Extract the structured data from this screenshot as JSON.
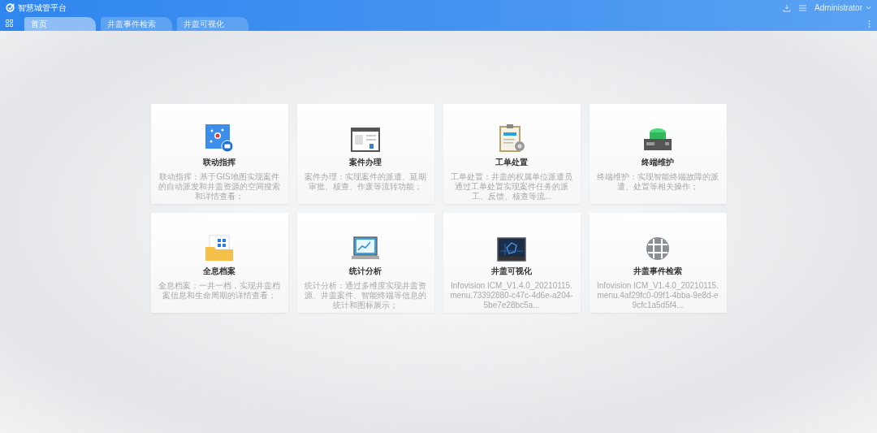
{
  "header": {
    "title": "智慧城管平台",
    "user": "Administrator"
  },
  "tabs": [
    {
      "label": "首页",
      "selected": true
    },
    {
      "label": "井盖事件检索",
      "selected": false
    },
    {
      "label": "井盖可视化",
      "selected": false
    }
  ],
  "modules": [
    {
      "kind": "network",
      "title": "联动指挥",
      "description": "联动指挥：基于GIS地图实现案件的自动派发和井盖资源的空间搜索和详情查看；"
    },
    {
      "kind": "document",
      "title": "案件办理",
      "description": "案件办理：实现案件的派遣、延期审批、核查、作废等流转功能；"
    },
    {
      "kind": "clipboard",
      "title": "工单处置",
      "description": "工单处置：井盖的权属单位派遣员通过工单处置实现案件任务的派工、反馈、核查等流..."
    },
    {
      "kind": "device",
      "title": "终端维护",
      "description": "终端维护：实现智能终端故障的派遣、处置等相关操作；"
    },
    {
      "kind": "folder",
      "title": "全息档案",
      "description": "全息档案：一井一档，实现井盖档案信息和生命周期的详情查看；"
    },
    {
      "kind": "laptop",
      "title": "统计分析",
      "description": "统计分析：通过多维度实现井盖资源、井盖案件、智能终端等信息的统计和图标展示；"
    },
    {
      "kind": "monitor",
      "title": "井盖可视化",
      "description": "Infovision ICM_V1.4.0_20210115.menu.73392880-c47c-4d6e-a204-5be7e28bc5a..."
    },
    {
      "kind": "globe",
      "title": "井盖事件检索",
      "description": "Infovision ICM_V1.4.0_20210115.menu.4af29fc0-09f1-4bba-9e8d-e9cfc1a5d5f4..."
    }
  ]
}
